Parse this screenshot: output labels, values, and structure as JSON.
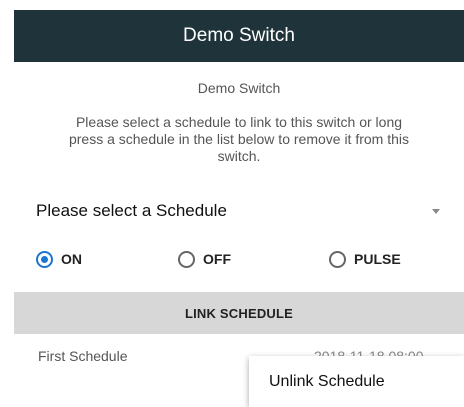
{
  "appbar": {
    "title": "Demo Switch"
  },
  "switch": {
    "name": "Demo Switch"
  },
  "instructions": "Please select a schedule to link to this switch or long press a schedule in the list below to remove it from this switch.",
  "spinner": {
    "selected": "Please select a Schedule"
  },
  "radios": [
    {
      "label": "ON",
      "checked": true
    },
    {
      "label": "OFF",
      "checked": false
    },
    {
      "label": "PULSE",
      "checked": false
    }
  ],
  "link_button": {
    "label": "LINK SCHEDULE"
  },
  "schedules": [
    {
      "name": "First Schedule",
      "time": "2018-11-18 08:00"
    }
  ],
  "popup": {
    "item": "Unlink Schedule"
  },
  "colors": {
    "appbar": "#1f333a",
    "accent": "#1976d2",
    "button": "#d7d7d7"
  }
}
